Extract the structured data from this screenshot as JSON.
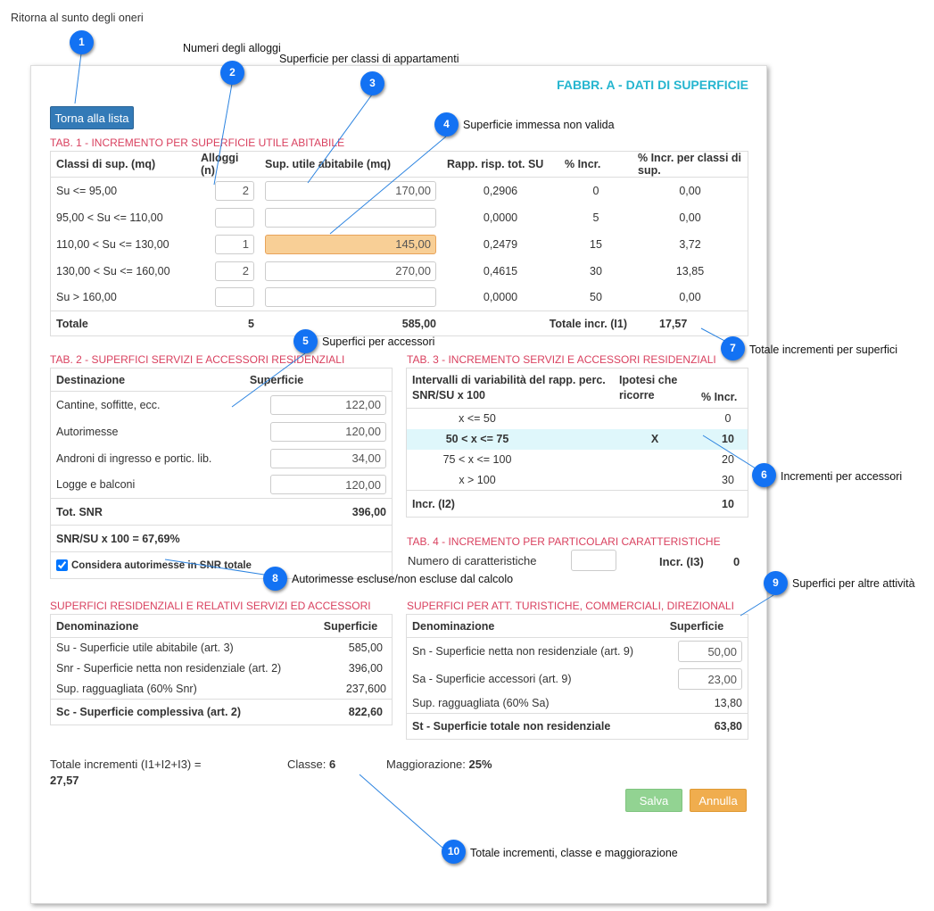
{
  "top_label": "Ritorna al sunto degli oneri",
  "form_title": "FABBR. A - DATI DI SUPERFICIE",
  "back_button": "Torna alla lista",
  "tab1": {
    "title": "TAB. 1 - INCREMENTO PER SUPERFICIE UTILE ABITABILE",
    "headers": [
      "Classi di sup. (mq)",
      "Alloggi (n)",
      "Sup. utile abitabile (mq)",
      "Rapp. risp. tot. SU",
      "% Incr.",
      "% Incr. per classi di sup."
    ],
    "rows": [
      {
        "cls": "Su <= 95,00",
        "alloggi": "2",
        "sup": "170,00",
        "rapp": "0,2906",
        "incr": "0",
        "incr_cls": "0,00"
      },
      {
        "cls": "95,00 < Su <= 110,00",
        "alloggi": "",
        "sup": "",
        "rapp": "0,0000",
        "incr": "5",
        "incr_cls": "0,00"
      },
      {
        "cls": "110,00 < Su <= 130,00",
        "alloggi": "1",
        "sup": "145,00",
        "rapp": "0,2479",
        "incr": "15",
        "incr_cls": "3,72"
      },
      {
        "cls": "130,00 < Su <= 160,00",
        "alloggi": "2",
        "sup": "270,00",
        "rapp": "0,4615",
        "incr": "30",
        "incr_cls": "13,85"
      },
      {
        "cls": "Su > 160,00",
        "alloggi": "",
        "sup": "",
        "rapp": "0,0000",
        "incr": "50",
        "incr_cls": "0,00"
      }
    ],
    "total_label": "Totale",
    "total_alloggi": "5",
    "total_sup": "585,00",
    "total_incr_label": "Totale incr. (I1)",
    "total_incr": "17,57"
  },
  "tab2": {
    "title": "TAB. 2 - SUPERFICI SERVIZI E ACCESSORI RESIDENZIALI",
    "headers": [
      "Destinazione",
      "Superficie"
    ],
    "rows": [
      {
        "dest": "Cantine, soffitte, ecc.",
        "sup": "122,00"
      },
      {
        "dest": "Autorimesse",
        "sup": "120,00"
      },
      {
        "dest": "Androni di ingresso e portic. lib.",
        "sup": "34,00"
      },
      {
        "dest": "Logge e balconi",
        "sup": "120,00"
      }
    ],
    "tot_label": "Tot. SNR",
    "tot_value": "396,00",
    "ratio": "SNR/SU x 100 = 67,69%",
    "checkbox_label": "Considera autorimesse in SNR totale"
  },
  "tab3": {
    "title": "TAB. 3 - INCREMENTO SERVIZI E ACCESSORI RESIDENZIALI",
    "headers": [
      "Intervalli di variabilità del rapp. perc. SNR/SU x 100",
      "Ipotesi che ricorre",
      "% Incr."
    ],
    "rows": [
      {
        "interval": "x <= 50",
        "mark": "",
        "incr": "0"
      },
      {
        "interval": "50 < x <= 75",
        "mark": "X",
        "incr": "10"
      },
      {
        "interval": "75 < x <= 100",
        "mark": "",
        "incr": "20"
      },
      {
        "interval": "x > 100",
        "mark": "",
        "incr": "30"
      }
    ],
    "incr_label": "Incr. (I2)",
    "incr_value": "10"
  },
  "tab4": {
    "title": "TAB. 4 - INCREMENTO PER PARTICOLARI CARATTERISTICHE",
    "num_label": "Numero di caratteristiche",
    "num_value": "",
    "incr_label": "Incr. (I3)",
    "incr_value": "0"
  },
  "res": {
    "title": "SUPERFICI RESIDENZIALI E RELATIVI SERVIZI ED ACCESSORI",
    "headers": [
      "Denominazione",
      "Superficie"
    ],
    "rows": [
      {
        "name": "Su - Superficie utile abitabile (art. 3)",
        "value": "585,00"
      },
      {
        "name": "Snr - Superficie netta non residenziale (art. 2)",
        "value": "396,00"
      },
      {
        "name": "Sup. ragguagliata (60% Snr)",
        "value": "237,600"
      }
    ],
    "total_label": "Sc - Superficie complessiva (art. 2)",
    "total_value": "822,60"
  },
  "att": {
    "title": "SUPERFICI PER ATT. TURISTICHE, COMMERCIALI, DIREZIONALI",
    "headers": [
      "Denominazione",
      "Superficie"
    ],
    "sn_label": "Sn - Superficie netta non residenziale (art. 9)",
    "sn_value": "50,00",
    "sa_label": "Sa - Superficie accessori (art. 9)",
    "sa_value": "23,00",
    "rag_label": "Sup. ragguagliata (60% Sa)",
    "rag_value": "13,80",
    "total_label": "St - Superficie totale non residenziale",
    "total_value": "63,80"
  },
  "summary": {
    "tot_label": "Totale incrementi (I1+I2+I3) =",
    "tot_value": "27,57",
    "classe_label": "Classe:",
    "classe_value": "6",
    "magg_label": "Maggiorazione:",
    "magg_value": "25%"
  },
  "save_button": "Salva",
  "cancel_button": "Annulla",
  "callouts": [
    {
      "n": "1",
      "label": ""
    },
    {
      "n": "2",
      "label": "Numeri degli alloggi"
    },
    {
      "n": "3",
      "label": "Superficie per classi di appartamenti"
    },
    {
      "n": "4",
      "label": "Superficie immessa non valida"
    },
    {
      "n": "5",
      "label": "Superfici per accessori"
    },
    {
      "n": "6",
      "label": "Incrementi per accessori"
    },
    {
      "n": "7",
      "label": "Totale incrementi per superfici"
    },
    {
      "n": "8",
      "label": "Autorimesse escluse/non escluse dal calcolo"
    },
    {
      "n": "9",
      "label": "Superfici per altre attività"
    },
    {
      "n": "10",
      "label": "Totale incrementi, classe e maggiorazione"
    }
  ],
  "colors": {
    "accent": "#25b5cf",
    "section": "#d9415f",
    "callout": "#1372f3",
    "primary": "#337ab7",
    "warning_input": "#f8cf96"
  }
}
